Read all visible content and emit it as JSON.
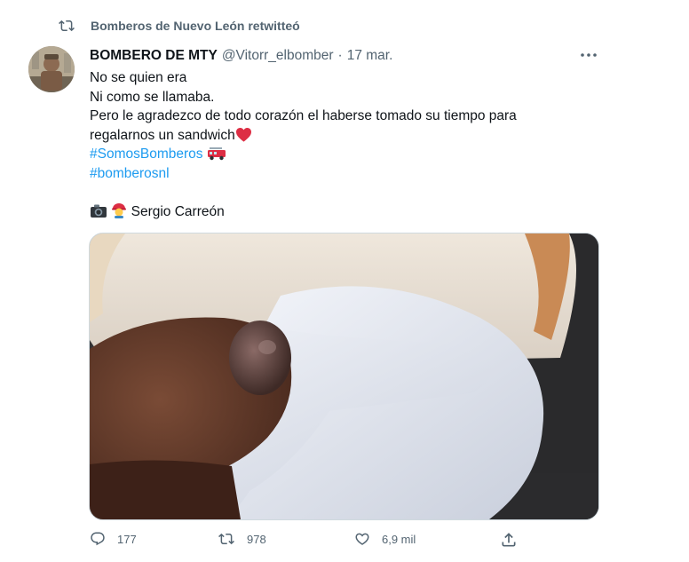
{
  "retweet": {
    "icon": "retweet-icon",
    "text": "Bomberos de Nuevo León retwitteó"
  },
  "tweet": {
    "author_name": "BOMBERO DE MTY",
    "author_handle": "@Vitorr_elbomber",
    "separator": "·",
    "date": "17 mar.",
    "lines": [
      "No se quien era",
      "Ni como se llamaba.",
      "Pero le agradezco de todo corazón el haberse tomado su tiempo para",
      "regalarnos un sandwich"
    ],
    "hashtags": [
      "#SomosBomberos",
      "#bomberosnl"
    ],
    "credit": "Sergio Carreón",
    "emoji_icons": [
      "red-heart-icon",
      "fire-engine-icon",
      "camera-icon",
      "firefighter-icon"
    ]
  },
  "actions": {
    "reply_count": "177",
    "retweet_count": "978",
    "like_count": "6,9 mil"
  },
  "colors": {
    "link": "#1d9bf0",
    "secondary_text": "#536471",
    "primary_text": "#0f1419",
    "heart": "#e0245e"
  }
}
